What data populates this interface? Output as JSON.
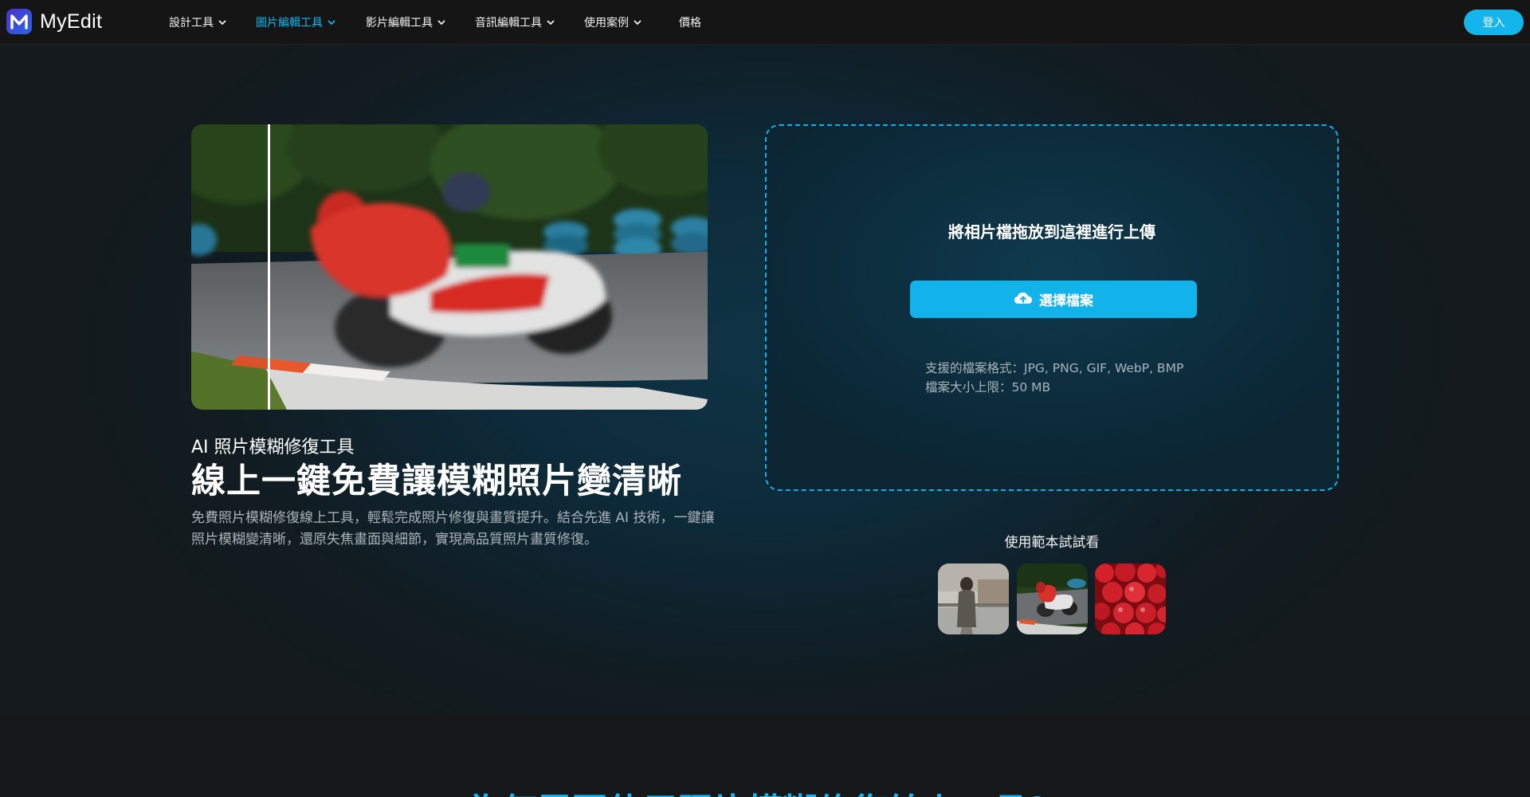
{
  "brand": {
    "name": "MyEdit"
  },
  "nav": {
    "items": [
      {
        "label": "設計工具"
      },
      {
        "label": "圖片編輯工具"
      },
      {
        "label": "影片編輯工具"
      },
      {
        "label": "音訊編輯工具"
      },
      {
        "label": "使用案例"
      },
      {
        "label": "價格"
      }
    ],
    "login_label": "登入"
  },
  "hero": {
    "eyebrow": "AI 照片模糊修復工具",
    "headline": "線上一鍵免費讓模糊照片變清晰",
    "description": "免費照片模糊修復線上工具，輕鬆完成照片修復與畫質提升。結合先進 AI 技術，一鍵讓照片模糊變清晰，還原失焦畫面與細節，實現高品質照片畫質修復。"
  },
  "upload": {
    "title": "將相片檔拖放到這裡進行上傳",
    "button_label": "選擇檔案",
    "formats_line": "支援的檔案格式：JPG, PNG, GIF, WebP, BMP",
    "size_line": "檔案大小上限：50 MB"
  },
  "samples": {
    "title": "使用範本試試看"
  },
  "section2": {
    "heading": "為何需要使用照片模糊修復線上工具？"
  },
  "colors": {
    "accent": "#13b5ea",
    "background": "#151718",
    "active_nav": "#12b6f0"
  },
  "icons": [
    "chevron-down-icon",
    "cloud-upload-icon"
  ]
}
